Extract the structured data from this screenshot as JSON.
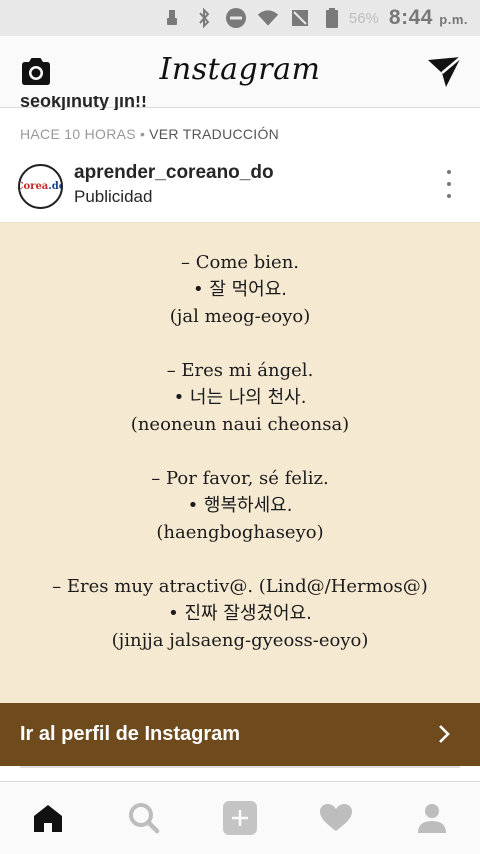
{
  "status_bar": {
    "battery_percent": "56%",
    "time": "8:44",
    "ampm": "p.m.",
    "icons": [
      "usb-icon",
      "bluetooth-icon",
      "do-not-disturb-icon",
      "wifi-icon",
      "no-signal-icon",
      "battery-icon"
    ]
  },
  "header": {
    "logo": "Instagram",
    "left_icon": "camera-icon",
    "right_icon": "direct-message-icon"
  },
  "previous_post": {
    "caption_fragment": "seokjinuty jin!!",
    "time_ago": "HACE 10 HORAS",
    "separator": "•",
    "translate_link": "VER TRADUCCIÓN"
  },
  "post": {
    "avatar_text_1": "Corea",
    "avatar_text_2": ".do",
    "username": "aprender_coreano_do",
    "sponsored_label": "Publicidad",
    "phrases": [
      {
        "es": "– Come bien.",
        "ko": "• 잘 먹어요.",
        "roman": "(jal meog-eoyo)"
      },
      {
        "es": "– Eres mi ángel.",
        "ko": "• 너는 나의 천사.",
        "roman": "(neoneun naui cheonsa)"
      },
      {
        "es": "– Por favor, sé feliz.",
        "ko": "• 행복하세요.",
        "roman": "(haengboghaseyo)"
      },
      {
        "es": "– Eres muy atractiv@. (Lind@/Hermos@)",
        "ko": "• 진짜 잘생겼어요.",
        "roman": "(jinjja jalsaeng-gyeoss-eoyo)"
      }
    ],
    "cta_label": "Ir al perfil de Instagram",
    "image_bg": "#f5e9d2",
    "cta_bg": "#6f4a1d"
  },
  "bottom_nav": {
    "items": [
      "home-icon",
      "search-icon",
      "add-post-icon",
      "activity-heart-icon",
      "profile-icon"
    ]
  }
}
